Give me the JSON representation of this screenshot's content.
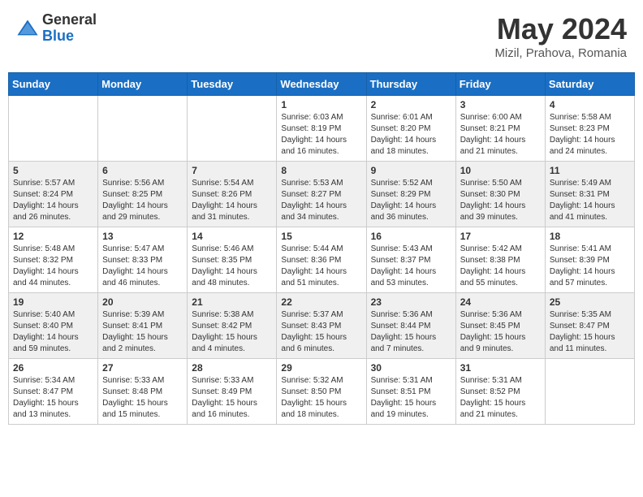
{
  "header": {
    "logo_general": "General",
    "logo_blue": "Blue",
    "month_title": "May 2024",
    "location": "Mizil, Prahova, Romania"
  },
  "days_of_week": [
    "Sunday",
    "Monday",
    "Tuesday",
    "Wednesday",
    "Thursday",
    "Friday",
    "Saturday"
  ],
  "weeks": [
    [
      {
        "day": "",
        "info": ""
      },
      {
        "day": "",
        "info": ""
      },
      {
        "day": "",
        "info": ""
      },
      {
        "day": "1",
        "info": "Sunrise: 6:03 AM\nSunset: 8:19 PM\nDaylight: 14 hours\nand 16 minutes."
      },
      {
        "day": "2",
        "info": "Sunrise: 6:01 AM\nSunset: 8:20 PM\nDaylight: 14 hours\nand 18 minutes."
      },
      {
        "day": "3",
        "info": "Sunrise: 6:00 AM\nSunset: 8:21 PM\nDaylight: 14 hours\nand 21 minutes."
      },
      {
        "day": "4",
        "info": "Sunrise: 5:58 AM\nSunset: 8:23 PM\nDaylight: 14 hours\nand 24 minutes."
      }
    ],
    [
      {
        "day": "5",
        "info": "Sunrise: 5:57 AM\nSunset: 8:24 PM\nDaylight: 14 hours\nand 26 minutes."
      },
      {
        "day": "6",
        "info": "Sunrise: 5:56 AM\nSunset: 8:25 PM\nDaylight: 14 hours\nand 29 minutes."
      },
      {
        "day": "7",
        "info": "Sunrise: 5:54 AM\nSunset: 8:26 PM\nDaylight: 14 hours\nand 31 minutes."
      },
      {
        "day": "8",
        "info": "Sunrise: 5:53 AM\nSunset: 8:27 PM\nDaylight: 14 hours\nand 34 minutes."
      },
      {
        "day": "9",
        "info": "Sunrise: 5:52 AM\nSunset: 8:29 PM\nDaylight: 14 hours\nand 36 minutes."
      },
      {
        "day": "10",
        "info": "Sunrise: 5:50 AM\nSunset: 8:30 PM\nDaylight: 14 hours\nand 39 minutes."
      },
      {
        "day": "11",
        "info": "Sunrise: 5:49 AM\nSunset: 8:31 PM\nDaylight: 14 hours\nand 41 minutes."
      }
    ],
    [
      {
        "day": "12",
        "info": "Sunrise: 5:48 AM\nSunset: 8:32 PM\nDaylight: 14 hours\nand 44 minutes."
      },
      {
        "day": "13",
        "info": "Sunrise: 5:47 AM\nSunset: 8:33 PM\nDaylight: 14 hours\nand 46 minutes."
      },
      {
        "day": "14",
        "info": "Sunrise: 5:46 AM\nSunset: 8:35 PM\nDaylight: 14 hours\nand 48 minutes."
      },
      {
        "day": "15",
        "info": "Sunrise: 5:44 AM\nSunset: 8:36 PM\nDaylight: 14 hours\nand 51 minutes."
      },
      {
        "day": "16",
        "info": "Sunrise: 5:43 AM\nSunset: 8:37 PM\nDaylight: 14 hours\nand 53 minutes."
      },
      {
        "day": "17",
        "info": "Sunrise: 5:42 AM\nSunset: 8:38 PM\nDaylight: 14 hours\nand 55 minutes."
      },
      {
        "day": "18",
        "info": "Sunrise: 5:41 AM\nSunset: 8:39 PM\nDaylight: 14 hours\nand 57 minutes."
      }
    ],
    [
      {
        "day": "19",
        "info": "Sunrise: 5:40 AM\nSunset: 8:40 PM\nDaylight: 14 hours\nand 59 minutes."
      },
      {
        "day": "20",
        "info": "Sunrise: 5:39 AM\nSunset: 8:41 PM\nDaylight: 15 hours\nand 2 minutes."
      },
      {
        "day": "21",
        "info": "Sunrise: 5:38 AM\nSunset: 8:42 PM\nDaylight: 15 hours\nand 4 minutes."
      },
      {
        "day": "22",
        "info": "Sunrise: 5:37 AM\nSunset: 8:43 PM\nDaylight: 15 hours\nand 6 minutes."
      },
      {
        "day": "23",
        "info": "Sunrise: 5:36 AM\nSunset: 8:44 PM\nDaylight: 15 hours\nand 7 minutes."
      },
      {
        "day": "24",
        "info": "Sunrise: 5:36 AM\nSunset: 8:45 PM\nDaylight: 15 hours\nand 9 minutes."
      },
      {
        "day": "25",
        "info": "Sunrise: 5:35 AM\nSunset: 8:47 PM\nDaylight: 15 hours\nand 11 minutes."
      }
    ],
    [
      {
        "day": "26",
        "info": "Sunrise: 5:34 AM\nSunset: 8:47 PM\nDaylight: 15 hours\nand 13 minutes."
      },
      {
        "day": "27",
        "info": "Sunrise: 5:33 AM\nSunset: 8:48 PM\nDaylight: 15 hours\nand 15 minutes."
      },
      {
        "day": "28",
        "info": "Sunrise: 5:33 AM\nSunset: 8:49 PM\nDaylight: 15 hours\nand 16 minutes."
      },
      {
        "day": "29",
        "info": "Sunrise: 5:32 AM\nSunset: 8:50 PM\nDaylight: 15 hours\nand 18 minutes."
      },
      {
        "day": "30",
        "info": "Sunrise: 5:31 AM\nSunset: 8:51 PM\nDaylight: 15 hours\nand 19 minutes."
      },
      {
        "day": "31",
        "info": "Sunrise: 5:31 AM\nSunset: 8:52 PM\nDaylight: 15 hours\nand 21 minutes."
      },
      {
        "day": "",
        "info": ""
      }
    ]
  ]
}
